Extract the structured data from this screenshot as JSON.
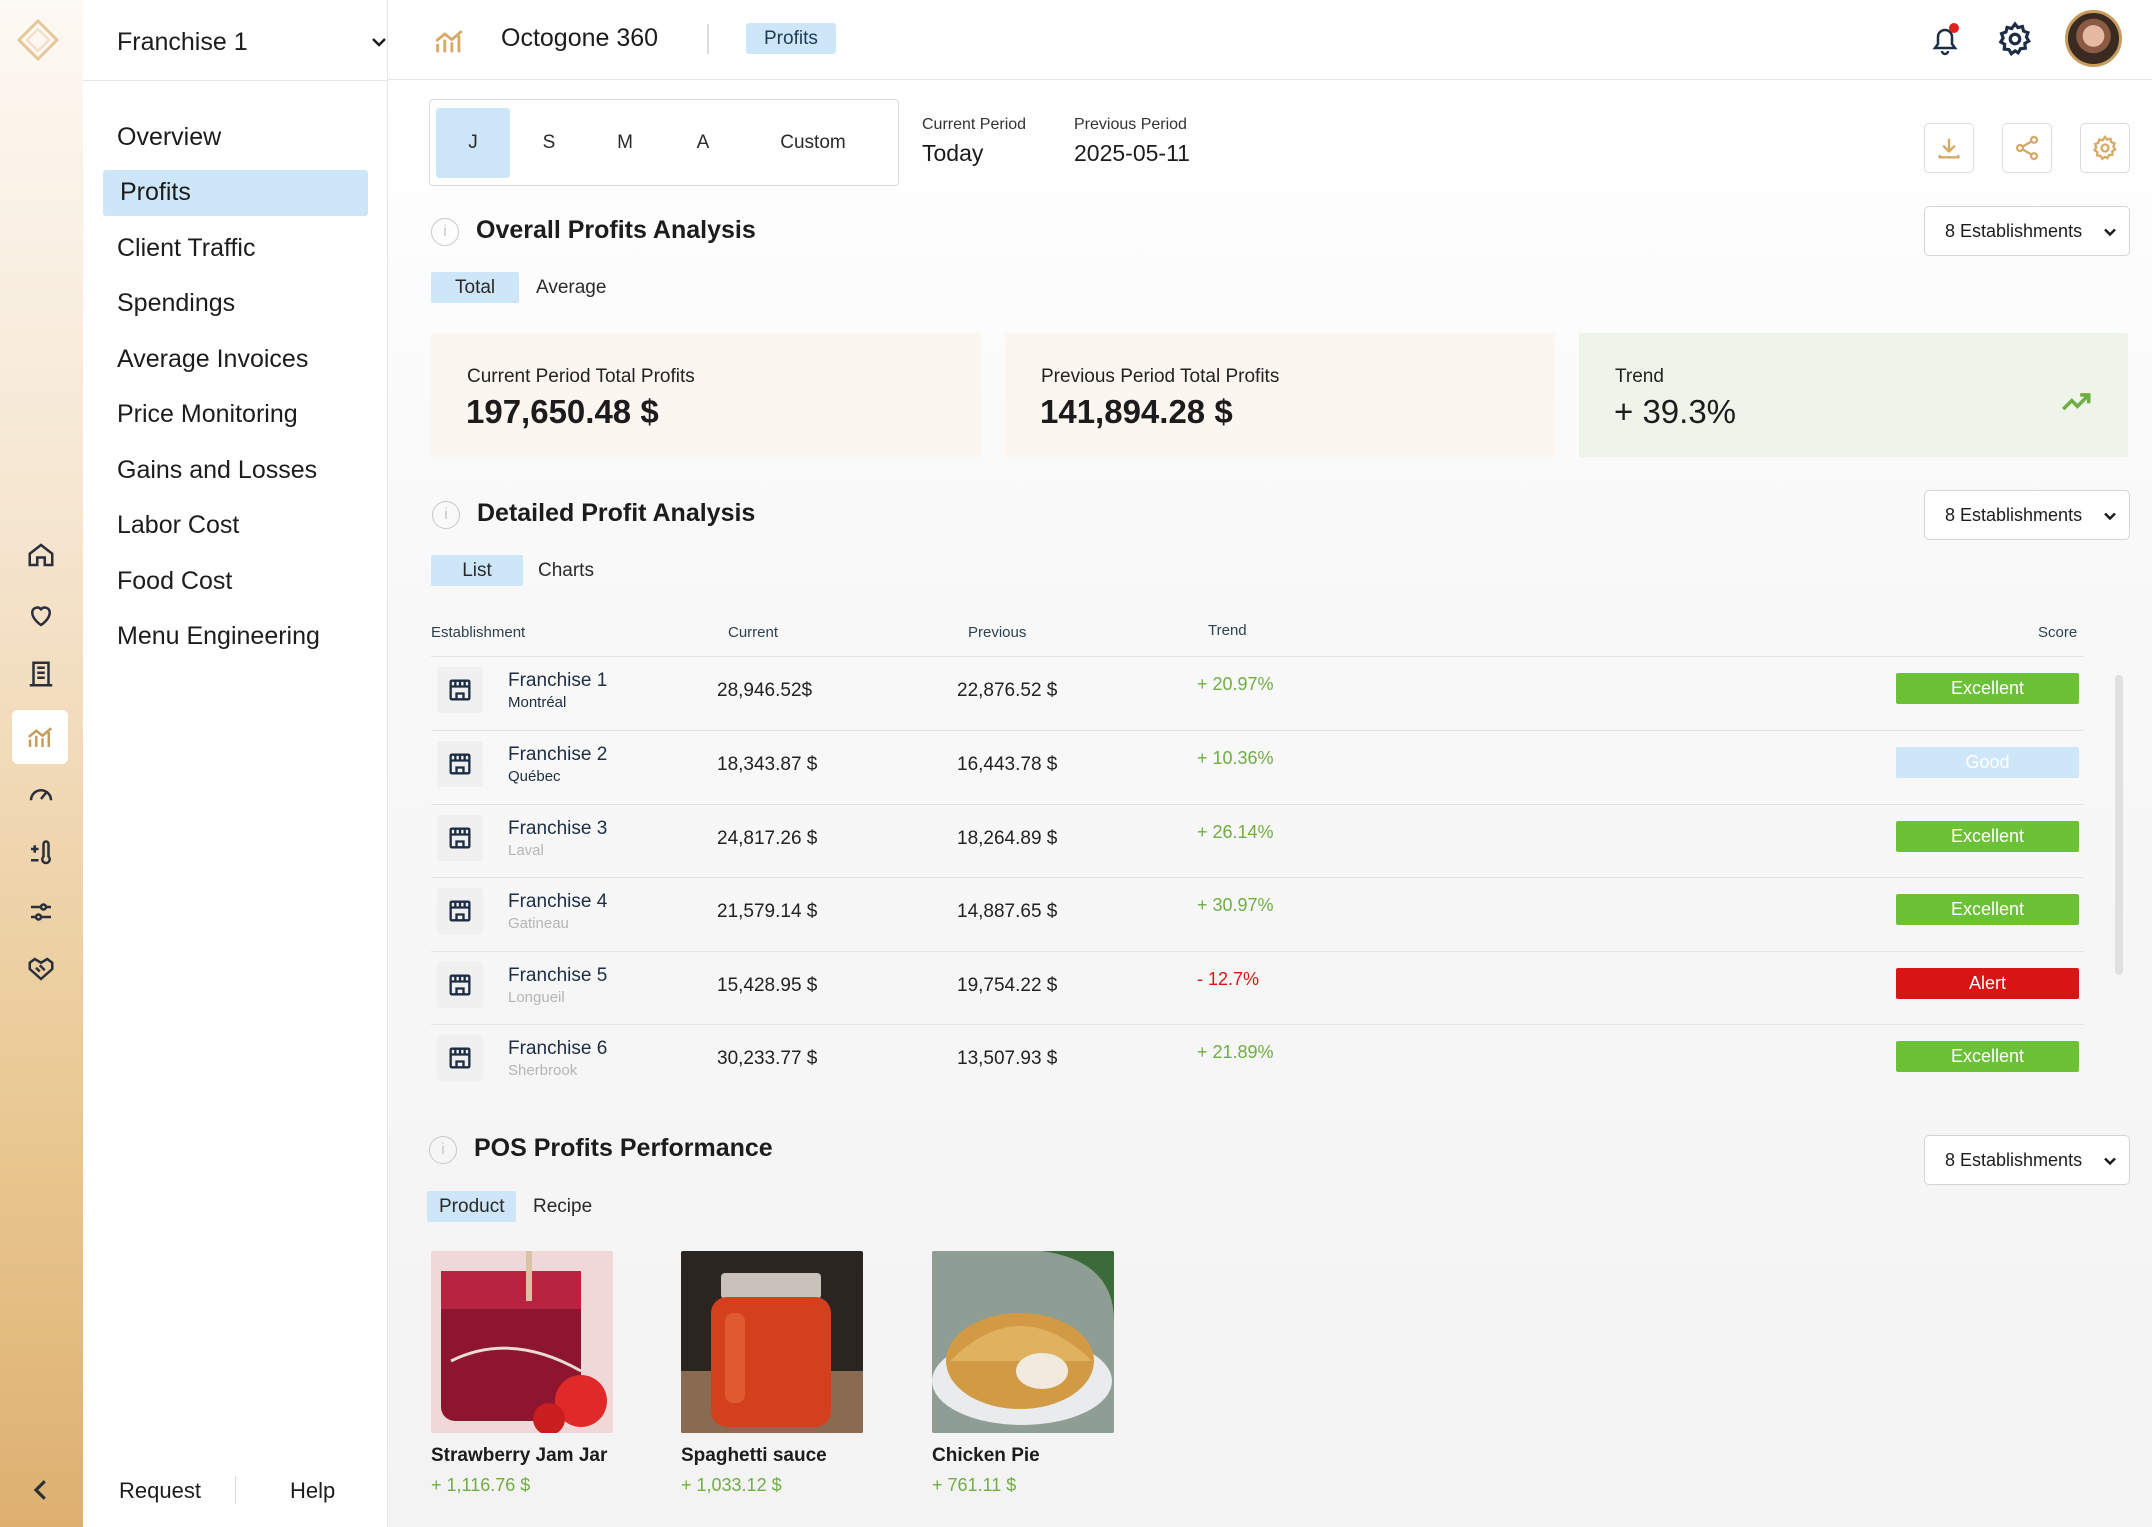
{
  "sidebar": {
    "franchise_selector": "Franchise 1",
    "items": [
      {
        "label": "Overview"
      },
      {
        "label": "Profits"
      },
      {
        "label": "Client Traffic"
      },
      {
        "label": "Spendings"
      },
      {
        "label": "Average Invoices"
      },
      {
        "label": "Price Monitoring"
      },
      {
        "label": "Gains and Losses"
      },
      {
        "label": "Labor Cost"
      },
      {
        "label": "Food Cost"
      },
      {
        "label": "Menu Engineering"
      }
    ],
    "footer": {
      "request": "Request",
      "help": "Help"
    }
  },
  "rail": {
    "icons": [
      "logo-icon",
      "home-icon",
      "heart-icon",
      "building-icon",
      "analytics-icon",
      "gauge-icon",
      "wellness-icon",
      "sliders-icon",
      "handshake-icon",
      "collapse-icon"
    ],
    "active_icon": "analytics-icon",
    "accent": "#c79d5d"
  },
  "header": {
    "app_title": "Octogone 360",
    "section_badge": "Profits",
    "notification_dot_color": "#e0201b"
  },
  "period": {
    "tabs": [
      "J",
      "S",
      "M",
      "A",
      "Custom"
    ],
    "active_tab": "J",
    "current_label": "Current Period",
    "current_value": "Today",
    "previous_label": "Previous Period",
    "previous_value": "2025-05-11"
  },
  "overall": {
    "title": "Overall Profits Analysis",
    "establishments": "8 Establishments",
    "toggle": [
      "Total",
      "Average"
    ],
    "cards": [
      {
        "label": "Current Period Total Profits",
        "value": "197,650.48 $"
      },
      {
        "label": "Previous Period Total Profits",
        "value": "141,894.28 $"
      },
      {
        "label": "Trend",
        "value": "+ 39.3%"
      }
    ]
  },
  "detailed": {
    "title": "Detailed Profit Analysis",
    "establishments": "8 Establishments",
    "toggle": [
      "List",
      "Charts"
    ],
    "columns": {
      "establishment": "Establishment",
      "current": "Current",
      "previous": "Previous",
      "trend": "Trend",
      "score": "Score"
    },
    "rows": [
      {
        "name": "Franchise 1",
        "city": "Montréal",
        "current": "28,946.52$",
        "previous": "22,876.52 $",
        "trend": "+ 20.97%",
        "score": "Excellent"
      },
      {
        "name": "Franchise 2",
        "city": "Québec",
        "current": "18,343.87 $",
        "previous": "16,443.78 $",
        "trend": "+ 10.36%",
        "score": "Good"
      },
      {
        "name": "Franchise 3",
        "city": "Laval",
        "current": "24,817.26 $",
        "previous": "18,264.89 $",
        "trend": "+ 26.14%",
        "score": "Excellent"
      },
      {
        "name": "Franchise 4",
        "city": "Gatineau",
        "current": "21,579.14 $",
        "previous": "14,887.65 $",
        "trend": "+ 30.97%",
        "score": "Excellent"
      },
      {
        "name": "Franchise 5",
        "city": "Longueil",
        "current": "15,428.95 $",
        "previous": "19,754.22 $",
        "trend": "- 12.7%",
        "score": "Alert"
      },
      {
        "name": "Franchise 6",
        "city": "Sherbrook",
        "current": "30,233.77 $",
        "previous": "13,507.93 $",
        "trend": "+ 21.89%",
        "score": "Excellent"
      }
    ],
    "score_colors": {
      "Excellent": "#6cc236",
      "Good": "#cde6f8",
      "Alert": "#d81414"
    },
    "trend_colors": {
      "up": "#6fae42",
      "down": "#d81414"
    }
  },
  "pos": {
    "title": "POS Profits Performance",
    "establishments": "8 Establishments",
    "toggle": [
      "Product",
      "Recipe"
    ],
    "products": [
      {
        "name": "Strawberry Jam Jar",
        "value": "+ 1,116.76 $"
      },
      {
        "name": "Spaghetti sauce",
        "value": "+ 1,033.12 $"
      },
      {
        "name": "Chicken Pie",
        "value": "+ 761.11 $"
      }
    ]
  }
}
